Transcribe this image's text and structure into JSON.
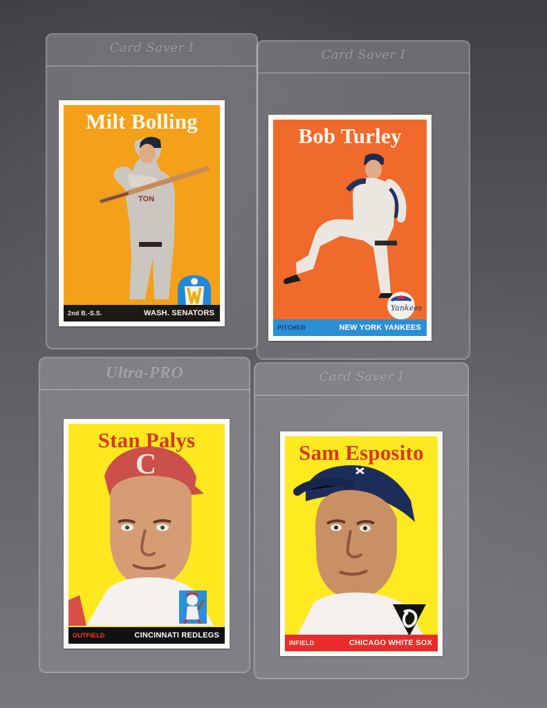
{
  "sleeves": [
    {
      "brand": "Card Saver I",
      "style": "card-saver"
    },
    {
      "brand": "Card Saver I",
      "style": "card-saver"
    },
    {
      "brand": "Ultra-PRO",
      "style": "ultra"
    },
    {
      "brand": "Card Saver I",
      "style": "card-saver"
    }
  ],
  "cards": [
    {
      "name": "Milt Bolling",
      "position": "2nd B.-S.S.",
      "team": "WASH. SENATORS",
      "name_color": "#fff8ee",
      "bg_color": "#f4a018",
      "bar_left_color": "#f3ece6",
      "bar_team_color": "#fff8ee",
      "bar_bg": "#1b1816",
      "logo_icon": "senators-logo-icon"
    },
    {
      "name": "Bob Turley",
      "position": "PITCHER",
      "team": "NEW YORK YANKEES",
      "name_color": "#fff8ee",
      "bg_color": "#f06a2b",
      "bar_left_color": "#1f3c72",
      "bar_team_color": "#ffffff",
      "bar_bg": "#2b8fd5",
      "logo_icon": "yankees-logo-icon"
    },
    {
      "name": "Stan Palys",
      "position": "OUTFIELD",
      "team": "CINCINNATI REDLEGS",
      "name_color": "#d23b24",
      "bg_color": "#ffe81f",
      "bar_left_color": "#ff3a22",
      "bar_team_color": "#ffffff",
      "bar_bg": "#111111",
      "logo_icon": "redlegs-logo-icon"
    },
    {
      "name": "Sam Esposito",
      "position": "INFIELD",
      "team": "CHICAGO WHITE SOX",
      "name_color": "#d73824",
      "bg_color": "#ffe921",
      "bar_left_color": "#fff1d4",
      "bar_team_color": "#fff8ef",
      "bar_bg": "#ea2b2b",
      "logo_icon": "white-sox-logo-icon"
    }
  ]
}
